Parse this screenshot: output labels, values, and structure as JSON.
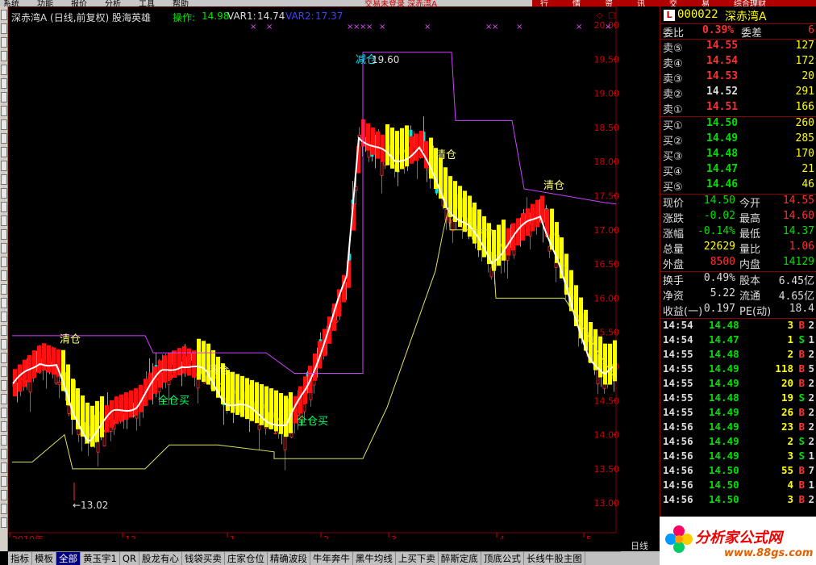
{
  "menu": [
    "系统",
    "功能",
    "报价",
    "分析",
    "工具",
    "帮助"
  ],
  "menu_right": [
    "行",
    "情",
    "资",
    "讯",
    "交",
    "易",
    "综合理财"
  ],
  "menu_notice": "交易未登录  深赤湾A",
  "chart": {
    "title": "深赤湾A (日线,前复权) 股海英雄",
    "op_label": "操作:",
    "op_value": "14.98",
    "var1_label": "VAR1:",
    "var1_value": "14.74",
    "var2_label": "VAR2:",
    "var2_value": "17.37",
    "price_labels": [
      "20.00",
      "19.50",
      "19.00",
      "18.50",
      "18.00",
      "17.50",
      "17.00",
      "16.50",
      "16.00",
      "15.50",
      "15.00",
      "14.50",
      "14.00",
      "13.50",
      "13.00"
    ],
    "high_label": "19.60",
    "low_label": "13.02",
    "annotations": {
      "sell_label": "清仓",
      "buy_label": "全仓买",
      "top_marker": "减仓"
    },
    "date_labels": [
      "2010年",
      "12",
      "1",
      "2",
      "3",
      "4",
      "5"
    ],
    "period": "日线"
  },
  "quote": {
    "code": "000022",
    "name": "深赤湾A",
    "badge": "L",
    "weibi": {
      "label": "委比",
      "value": "0.39%",
      "label2": "委差",
      "value2": "6"
    },
    "sell": [
      {
        "label": "卖⑤",
        "price": "14.55",
        "vol": "127"
      },
      {
        "label": "卖④",
        "price": "14.54",
        "vol": "172"
      },
      {
        "label": "卖③",
        "price": "14.53",
        "vol": "20"
      },
      {
        "label": "卖②",
        "price": "14.52",
        "vol": "291"
      },
      {
        "label": "卖①",
        "price": "14.51",
        "vol": "166"
      }
    ],
    "buy": [
      {
        "label": "买①",
        "price": "14.50",
        "vol": "260"
      },
      {
        "label": "买②",
        "price": "14.49",
        "vol": "285"
      },
      {
        "label": "买③",
        "price": "14.48",
        "vol": "170"
      },
      {
        "label": "买④",
        "price": "14.47",
        "vol": "21"
      },
      {
        "label": "买⑤",
        "price": "14.46",
        "vol": "46"
      }
    ],
    "stats": [
      {
        "l1": "现价",
        "v1": "14.50",
        "c1": "#00e000",
        "l2": "今开",
        "v2": "14.55",
        "c2": "#ff3030"
      },
      {
        "l1": "涨跌",
        "v1": "-0.02",
        "c1": "#00e000",
        "l2": "最高",
        "v2": "14.60",
        "c2": "#ff3030"
      },
      {
        "l1": "涨幅",
        "v1": "-0.14%",
        "c1": "#00e000",
        "l2": "最低",
        "v2": "14.37",
        "c2": "#00e000"
      },
      {
        "l1": "总量",
        "v1": "22629",
        "c1": "#ffff00",
        "l2": "量比",
        "v2": "1.06",
        "c2": "#ff3030"
      },
      {
        "l1": "外盘",
        "v1": "8500",
        "c1": "#ff3030",
        "l2": "内盘",
        "v2": "14129",
        "c2": "#00e000"
      }
    ],
    "stats2": [
      {
        "l1": "换手",
        "v1": "0.49%",
        "c1": "#ddd",
        "l2": "股本",
        "v2": "6.45亿",
        "c2": "#ddd"
      },
      {
        "l1": "净资",
        "v1": "5.22",
        "c1": "#ddd",
        "l2": "流通",
        "v2": "4.65亿",
        "c2": "#ddd"
      },
      {
        "l1": "收益(一)",
        "v1": "0.197",
        "c1": "#ddd",
        "l2": "PE(动)",
        "v2": "18.4",
        "c2": "#ddd"
      }
    ],
    "ticks": [
      {
        "t": "14:54",
        "p": "14.48",
        "v": "3",
        "bs": "B",
        "n": "2"
      },
      {
        "t": "14:54",
        "p": "14.47",
        "v": "1",
        "bs": "S",
        "n": "1"
      },
      {
        "t": "14:55",
        "p": "14.48",
        "v": "2",
        "bs": "B",
        "n": "2"
      },
      {
        "t": "14:55",
        "p": "14.49",
        "v": "118",
        "bs": "B",
        "n": "5"
      },
      {
        "t": "14:55",
        "p": "14.49",
        "v": "20",
        "bs": "B",
        "n": "2"
      },
      {
        "t": "14:55",
        "p": "14.48",
        "v": "19",
        "bs": "S",
        "n": "2"
      },
      {
        "t": "14:55",
        "p": "14.49",
        "v": "26",
        "bs": "B",
        "n": "2"
      },
      {
        "t": "14:56",
        "p": "14.49",
        "v": "23",
        "bs": "B",
        "n": "2"
      },
      {
        "t": "14:56",
        "p": "14.49",
        "v": "2",
        "bs": "S",
        "n": "2"
      },
      {
        "t": "14:56",
        "p": "14.49",
        "v": "3",
        "bs": "S",
        "n": "1"
      },
      {
        "t": "14:56",
        "p": "14.50",
        "v": "55",
        "bs": "B",
        "n": "7"
      },
      {
        "t": "14:56",
        "p": "14.50",
        "v": "4",
        "bs": "B",
        "n": "1"
      },
      {
        "t": "14:56",
        "p": "14.50",
        "v": "3",
        "bs": "B",
        "n": "2"
      }
    ]
  },
  "tabs": [
    "指标",
    "模板",
    "全部",
    "黄玉宇1",
    "QR",
    "股龙有心",
    "钱袋买卖",
    "庄家仓位",
    "精确波段",
    "牛年奔牛",
    "黑牛均线",
    "上买下卖",
    "醉斯定底",
    "顶底公式",
    "长线牛股主图"
  ],
  "active_tab": "全部",
  "watermark": {
    "line1": "分析家公式网",
    "line2": "www.88gs.com"
  },
  "colors": {
    "up": "#ff3030",
    "down": "#00e000",
    "vol": "#ffff00",
    "accent": "#b00000"
  }
}
